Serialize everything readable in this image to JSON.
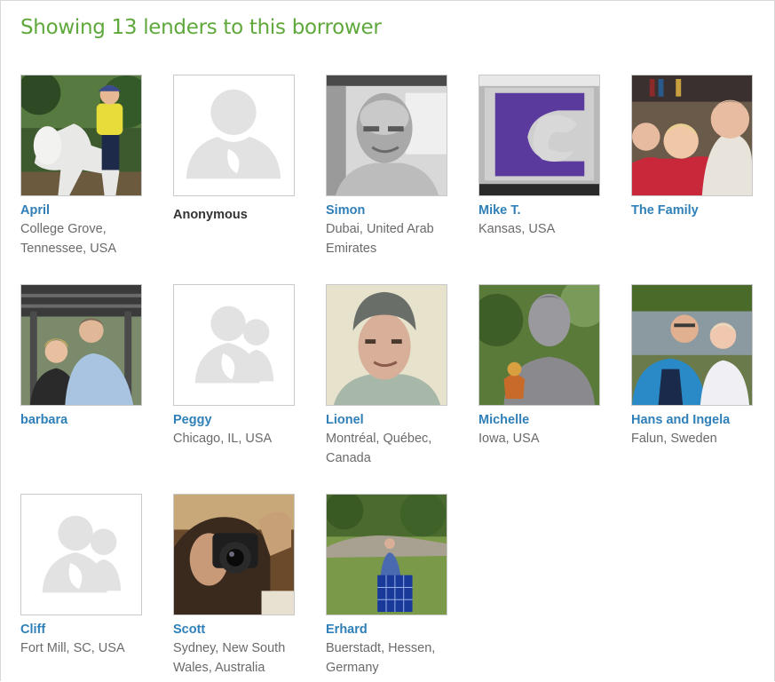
{
  "heading": "Showing 13 lenders to this borrower",
  "lenders": [
    {
      "name": "April",
      "location": "College Grove, Tennessee, USA",
      "photo": "horse-rider-photo"
    },
    {
      "name": "Anonymous",
      "location": "",
      "photo": "anonymous-person-icon"
    },
    {
      "name": "Simon",
      "location": "Dubai, United Arab Emirates",
      "photo": "man-portrait-photo"
    },
    {
      "name": "Mike T.",
      "location": "Kansas, USA",
      "photo": "kansas-state-logo-photo"
    },
    {
      "name": "The Family",
      "location": "",
      "photo": "family-photo"
    },
    {
      "name": "barbara",
      "location": "",
      "photo": "couple-pergola-photo"
    },
    {
      "name": "Peggy",
      "location": "Chicago, IL, USA",
      "photo": "group-placeholder-icon"
    },
    {
      "name": "Lionel",
      "location": "Montréal, Québec, Canada",
      "photo": "man-beanie-photo"
    },
    {
      "name": "Michelle",
      "location": "Iowa, USA",
      "photo": "buddha-statue-photo"
    },
    {
      "name": "Hans and Ingela",
      "location": "Falun, Sweden",
      "photo": "couple-river-photo"
    },
    {
      "name": "Cliff",
      "location": "Fort Mill, SC, USA",
      "photo": "group-placeholder-icon"
    },
    {
      "name": "Scott",
      "location": "Sydney, New South Wales, Australia",
      "photo": "camera-selfie-photo"
    },
    {
      "name": "Erhard",
      "location": "Buerstadt, Hessen, Germany",
      "photo": "solar-panel-photo"
    }
  ]
}
